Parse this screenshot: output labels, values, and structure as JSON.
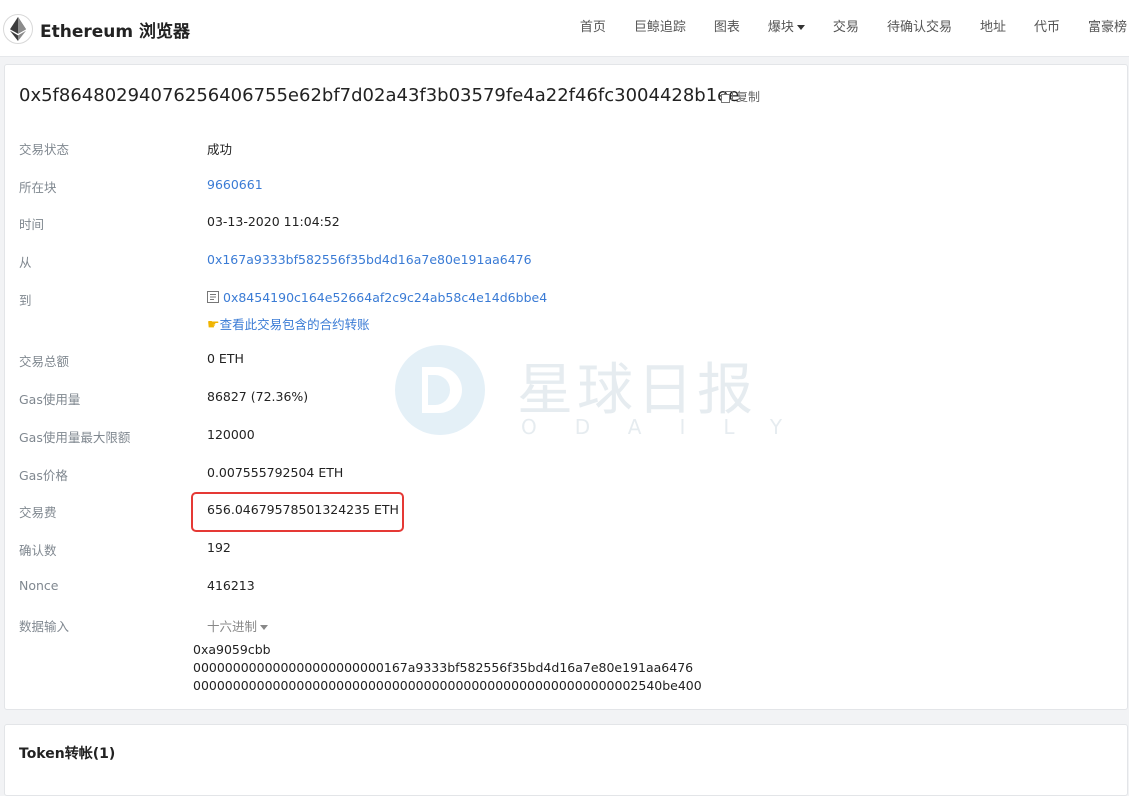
{
  "header": {
    "brand": "Ethereum 浏览器",
    "nav": [
      "首页",
      "巨鲸追踪",
      "图表",
      "爆块",
      "交易",
      "待确认交易",
      "地址",
      "代币",
      "富豪榜"
    ]
  },
  "tx": {
    "hash": "0x5f86480294076256406755e62bf7d02a43f3b03579fe4a22f46fc3004428b1ee",
    "copy_label": "复制"
  },
  "fields": {
    "status": {
      "label": "交易状态",
      "value": "成功"
    },
    "block": {
      "label": "所在块",
      "value": "9660661"
    },
    "time": {
      "label": "时间",
      "value": "03-13-2020 11:04:52"
    },
    "from": {
      "label": "从",
      "value": "0x167a9333bf582556f35bd4d16a7e80e191aa6476"
    },
    "to": {
      "label": "到",
      "value": "0x8454190c164e52664af2c9c24ab58c4e14d6bbe4",
      "sub_link": "查看此交易包含的合约转账"
    },
    "total": {
      "label": "交易总额",
      "value": "0 ETH"
    },
    "gas_used": {
      "label": "Gas使用量",
      "value": "86827 (72.36%)"
    },
    "gas_limit": {
      "label": "Gas使用量最大限额",
      "value": "120000"
    },
    "gas_price": {
      "label": "Gas价格",
      "value": "0.007555792504 ETH"
    },
    "fee": {
      "label": "交易费",
      "value": "656.04679578501324235 ETH"
    },
    "confirmations": {
      "label": "确认数",
      "value": "192"
    },
    "nonce": {
      "label": "Nonce",
      "value": "416213"
    },
    "input": {
      "label": "数据输入",
      "format": "十六进制",
      "lines": [
        "0xa9059cbb",
        "000000000000000000000000167a9333bf582556f35bd4d16a7e80e191aa6476",
        "00000000000000000000000000000000000000000000000000000002540be400"
      ]
    }
  },
  "token_section": {
    "title": "Token转帐(1)"
  },
  "watermark": {
    "cn": "星球日报",
    "en": "ODAILY"
  }
}
